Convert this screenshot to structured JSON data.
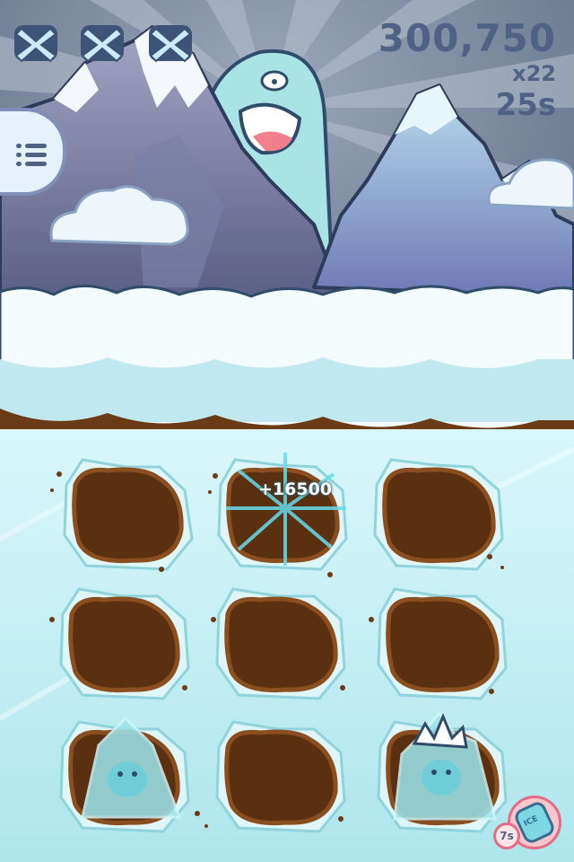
{
  "hud": {
    "lives": [
      {
        "state": "lost",
        "icon": "crossed-life-icon"
      },
      {
        "state": "lost",
        "icon": "crossed-life-icon"
      },
      {
        "state": "lost",
        "icon": "crossed-life-icon"
      }
    ],
    "score": "300,750",
    "combo": "x22",
    "time_remaining": "25s",
    "menu_icon": "list-menu-icon"
  },
  "board": {
    "rows": 3,
    "cols": 3,
    "holes": [
      {
        "row": 1,
        "col": 1,
        "contents": "empty"
      },
      {
        "row": 1,
        "col": 2,
        "contents": "hit-burst"
      },
      {
        "row": 1,
        "col": 3,
        "contents": "empty"
      },
      {
        "row": 2,
        "col": 1,
        "contents": "empty"
      },
      {
        "row": 2,
        "col": 2,
        "contents": "empty"
      },
      {
        "row": 2,
        "col": 3,
        "contents": "empty"
      },
      {
        "row": 3,
        "col": 1,
        "contents": "frozen-creature"
      },
      {
        "row": 3,
        "col": 2,
        "contents": "empty"
      },
      {
        "row": 3,
        "col": 3,
        "contents": "frozen-creature-spiky"
      }
    ],
    "score_popup": "+16500"
  },
  "powerup": {
    "icon": "ice-jar-icon",
    "label": "ICE",
    "count": "7s"
  },
  "colors": {
    "hud_text": "#4f6285",
    "sky": "#6b7b93",
    "ice_floor": "#bfeff3",
    "dirt": "#6b3b16",
    "snow": "#f4fbfd"
  }
}
